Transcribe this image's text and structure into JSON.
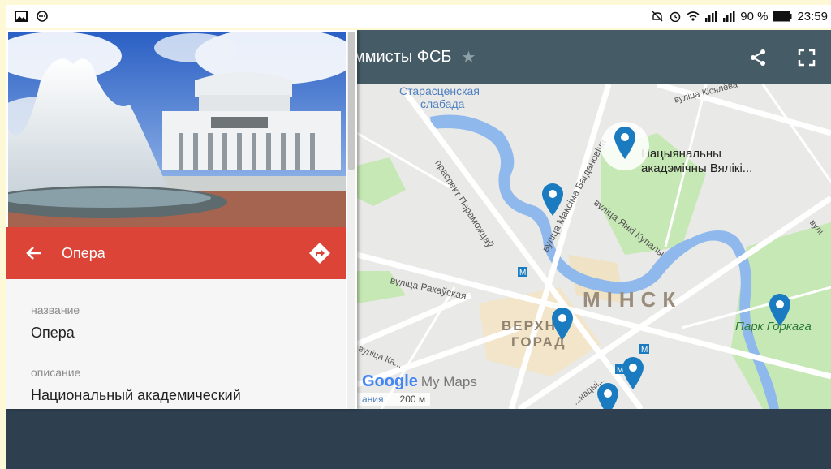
{
  "status": {
    "battery": "90 %",
    "time": "23:59",
    "icons": [
      "image-icon",
      "chat-icon",
      "mute-icon",
      "alarm-icon",
      "wifi-icon",
      "signal-icon",
      "signal-icon-2",
      "battery-icon"
    ]
  },
  "map": {
    "title": "ммисты ФСБ",
    "labels": {
      "starostsen": "Старасценская",
      "slabada": "слабада",
      "kisialiova": "вуліца Кісялёва",
      "national": "Нацыянальны",
      "academic": "акадэмічны Вялікі...",
      "peramozhcau": "праспект Пераможцаў",
      "bagdanovich": "вуліца Максіма Багдановіча",
      "kupala": "вуліца Янкі Купалы",
      "rakauskaja": "вуліца Ракаўская",
      "minsk": "МІНСК",
      "verkhni": "ВЕРХНІ",
      "horad": "ГОРАД",
      "park": "Парк Горкага",
      "kalvaryjskaja": "вуліца Ка...",
      "internatsyanalnaja": "...нацыі...",
      "edge": "вулі"
    },
    "google_logo": "Google",
    "my_maps": "My Maps",
    "attrib": "ания",
    "scale": "200 м"
  },
  "place": {
    "name": "Опера",
    "title_label": "название",
    "title_value": "Опера",
    "desc_label": "описание",
    "desc_value": "Национальный академический"
  },
  "colors": {
    "accent_red": "#db4437",
    "map_header": "#455b66",
    "pin_blue": "#1a7bc0",
    "park_green": "#c6e8b4",
    "water_blue": "#8fb8ec"
  }
}
